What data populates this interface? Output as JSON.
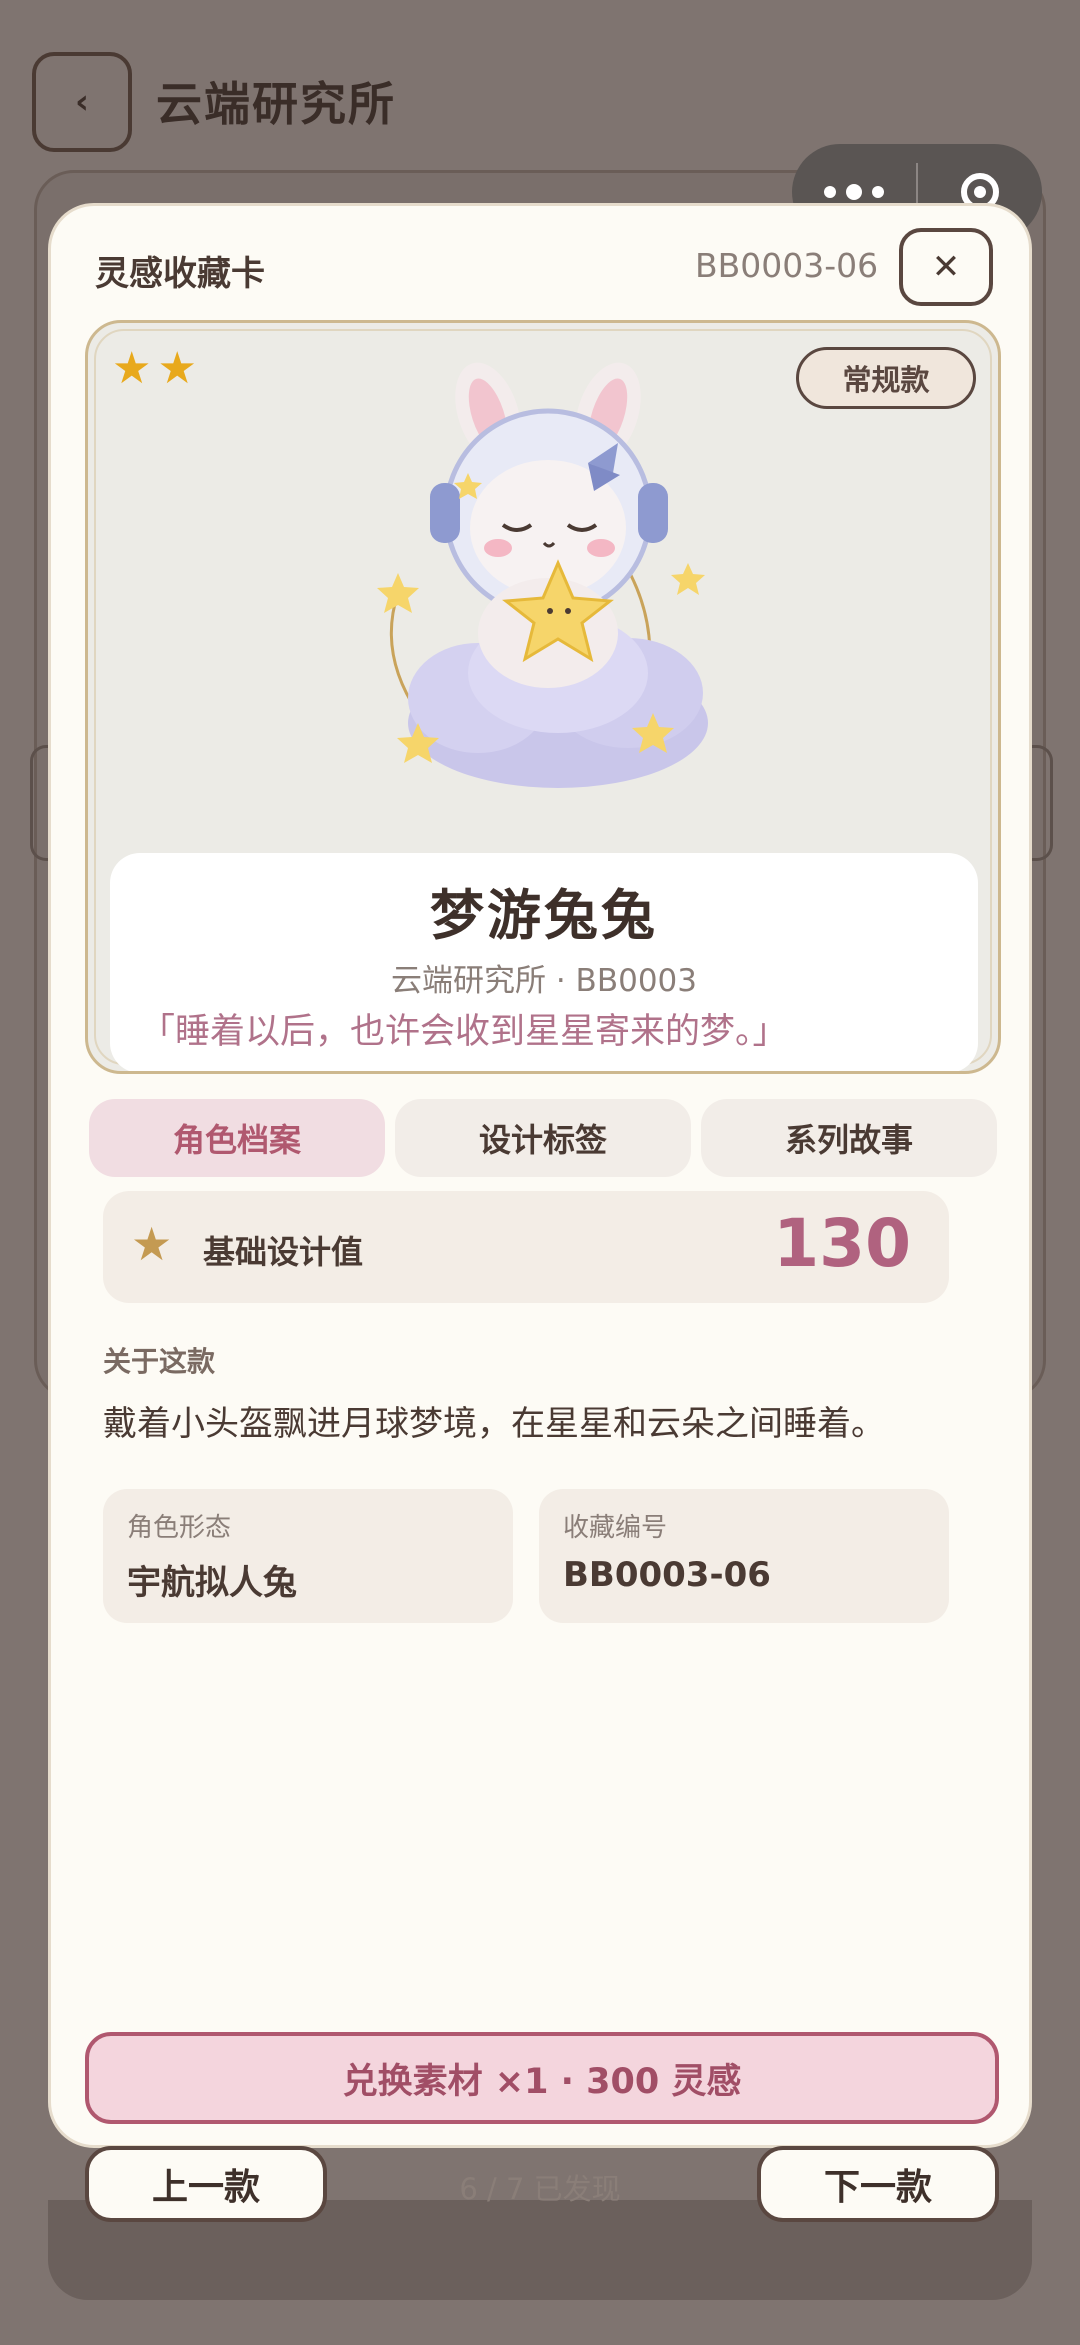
{
  "page": {
    "back_label": "‹",
    "title": "云端研究所"
  },
  "capsule": {
    "more_icon": "more-dots-icon",
    "close_icon": "target-ring-icon"
  },
  "card": {
    "title": "灵感收藏卡",
    "code": "BB0003-06",
    "close_label": "✕",
    "rarity_stars": 2,
    "star_glyph": "★",
    "badge": "常规款",
    "character": {
      "name": "梦游兔兔",
      "subtitle": "云端研究所 · BB0003",
      "quote": "「睡着以后，也许会收到星星寄来的梦。」"
    },
    "tabs": [
      {
        "label": "角色档案",
        "active": true
      },
      {
        "label": "设计标签",
        "active": false
      },
      {
        "label": "系列故事",
        "active": false
      }
    ],
    "stat": {
      "label": "基础设计值",
      "value": "130"
    },
    "about": {
      "title": "关于这款",
      "text": "戴着小头盔飘进月球梦境，在星星和云朵之间睡着。"
    },
    "meta": {
      "form_label": "角色形态",
      "form_value": "宇航拟人兔",
      "number_label": "收藏编号",
      "number_value": "BB0003-06"
    },
    "exchange_label": "兑换素材 ×1 · 300 灵感",
    "prev_label": "上一款",
    "next_label": "下一款",
    "progress_text": "6 / 7 已发现"
  },
  "colors": {
    "accent_pink": "#b0586f",
    "star_gold": "#e8a91c",
    "card_bg": "#fdfbf5"
  }
}
